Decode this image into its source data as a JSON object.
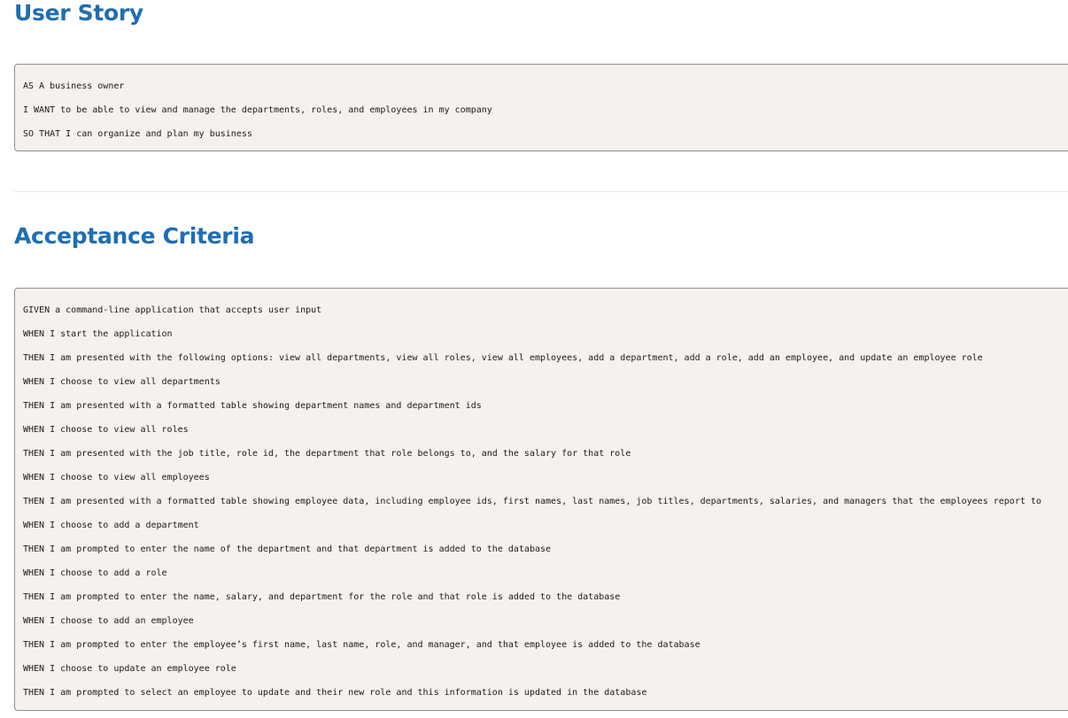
{
  "user_story": {
    "title": "User Story",
    "lines": [
      "AS A business owner",
      "I WANT to be able to view and manage the departments, roles, and employees in my company",
      "SO THAT I can organize and plan my business"
    ]
  },
  "acceptance_criteria": {
    "title": "Acceptance Criteria",
    "lines": [
      "GIVEN a command-line application that accepts user input",
      "WHEN I start the application",
      "THEN I am presented with the following options: view all departments, view all roles, view all employees, add a department, add a role, add an employee, and update an employee role",
      "WHEN I choose to view all departments",
      "THEN I am presented with a formatted table showing department names and department ids",
      "WHEN I choose to view all roles",
      "THEN I am presented with the job title, role id, the department that role belongs to, and the salary for that role",
      "WHEN I choose to view all employees",
      "THEN I am presented with a formatted table showing employee data, including employee ids, first names, last names, job titles, departments, salaries, and managers that the employees report to",
      "WHEN I choose to add a department",
      "THEN I am prompted to enter the name of the department and that department is added to the database",
      "WHEN I choose to add a role",
      "THEN I am prompted to enter the name, salary, and department for the role and that role is added to the database",
      "WHEN I choose to add an employee",
      "THEN I am prompted to enter the employee’s first name, last name, role, and manager, and that employee is added to the database",
      "WHEN I choose to update an employee role",
      "THEN I am prompted to select an employee to update and their new role and this information is updated in the database"
    ]
  }
}
